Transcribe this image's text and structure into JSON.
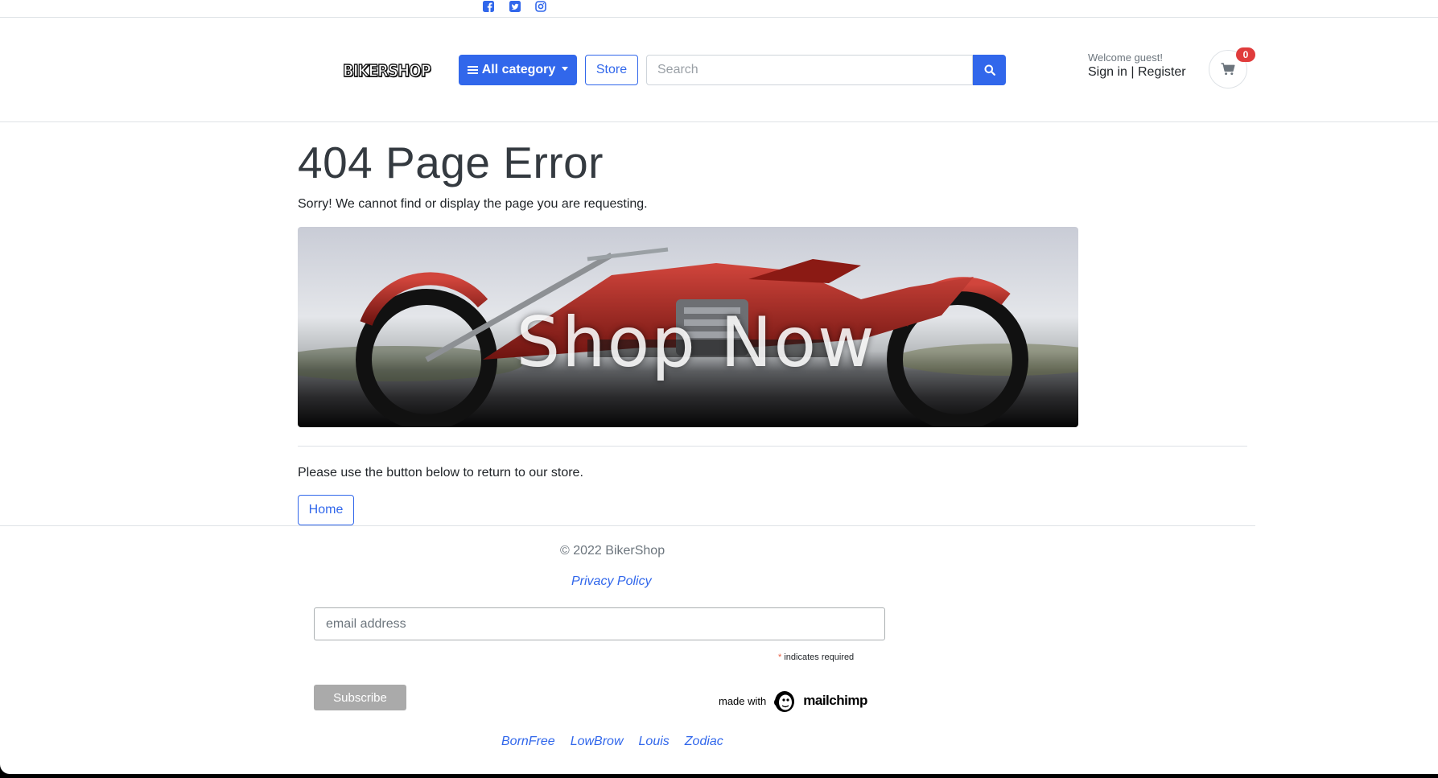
{
  "social": {
    "icons": [
      "facebook-icon",
      "twitter-icon",
      "instagram-icon"
    ],
    "color": "#3167eb"
  },
  "header": {
    "logo_text": "BIKERSHOP",
    "category_label": "All category",
    "store_label": "Store",
    "search_placeholder": "Search",
    "welcome": "Welcome guest!",
    "sign_in": "Sign in",
    "separator": "|",
    "register": "Register",
    "cart_count": "0"
  },
  "main": {
    "title": "404 Page Error",
    "message": "Sorry! We cannot find or display the page you are requesting.",
    "banner_text": "Shop Now",
    "instruction": "Please use the button below to return to our store.",
    "home_label": "Home"
  },
  "footer": {
    "copyright": "© 2022 BikerShop",
    "privacy": "Privacy Policy",
    "email_placeholder": "email address",
    "required_mark": "*",
    "required_text": "indicates required",
    "subscribe_label": "Subscribe",
    "made_with": "made with",
    "mailchimp": "mailchimp",
    "brands": [
      "BornFree",
      "LowBrow",
      "Louis",
      "Zodiac"
    ]
  },
  "colors": {
    "accent": "#3167eb",
    "badge": "#e03c3c",
    "subscribe": "#aaaaaa"
  }
}
